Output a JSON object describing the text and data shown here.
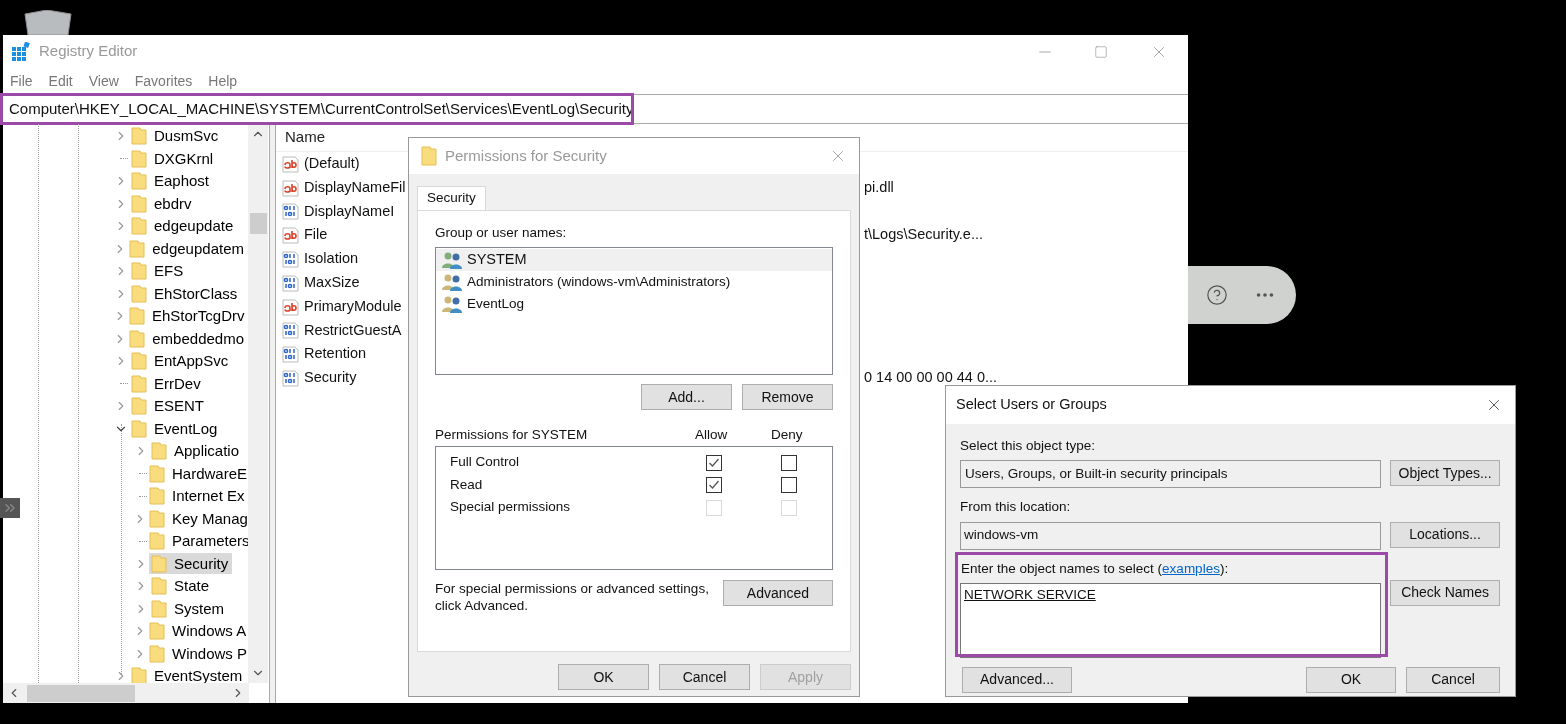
{
  "registry_editor": {
    "title": "Registry Editor",
    "menu": [
      "File",
      "Edit",
      "View",
      "Favorites",
      "Help"
    ],
    "address": "Computer\\HKEY_LOCAL_MACHINE\\SYSTEM\\CurrentControlSet\\Services\\EventLog\\Security",
    "tree": [
      {
        "name": "DusmSvc",
        "kind": "branch",
        "expanded": false,
        "selected": false
      },
      {
        "name": "DXGKrnl",
        "kind": "leaf",
        "selected": false
      },
      {
        "name": "Eaphost",
        "kind": "branch",
        "expanded": false,
        "selected": false
      },
      {
        "name": "ebdrv",
        "kind": "branch",
        "expanded": false,
        "selected": false
      },
      {
        "name": "edgeupdate",
        "kind": "branch",
        "expanded": false,
        "selected": false
      },
      {
        "name": "edgeupdatem",
        "kind": "branch",
        "expanded": false,
        "selected": false
      },
      {
        "name": "EFS",
        "kind": "branch",
        "expanded": false,
        "selected": false
      },
      {
        "name": "EhStorClass",
        "kind": "branch",
        "expanded": false,
        "selected": false
      },
      {
        "name": "EhStorTcgDrv",
        "kind": "branch",
        "expanded": false,
        "selected": false
      },
      {
        "name": "embeddedmo",
        "kind": "branch",
        "expanded": false,
        "selected": false
      },
      {
        "name": "EntAppSvc",
        "kind": "branch",
        "expanded": false,
        "selected": false
      },
      {
        "name": "ErrDev",
        "kind": "leaf",
        "selected": false
      },
      {
        "name": "ESENT",
        "kind": "branch",
        "expanded": false,
        "selected": false
      },
      {
        "name": "EventLog",
        "kind": "branch",
        "expanded": true,
        "selected": false,
        "children": [
          {
            "name": "Applicatio",
            "kind": "branch",
            "expanded": false,
            "selected": false
          },
          {
            "name": "HardwareE",
            "kind": "leaf",
            "selected": false
          },
          {
            "name": "Internet Ex",
            "kind": "leaf",
            "selected": false
          },
          {
            "name": "Key Manag",
            "kind": "branch",
            "expanded": false,
            "selected": false
          },
          {
            "name": "Parameters",
            "kind": "leaf",
            "selected": false
          },
          {
            "name": "Security",
            "kind": "branch",
            "expanded": false,
            "selected": true
          },
          {
            "name": "State",
            "kind": "branch",
            "expanded": false,
            "selected": false
          },
          {
            "name": "System",
            "kind": "branch",
            "expanded": false,
            "selected": false
          },
          {
            "name": "Windows A",
            "kind": "branch",
            "expanded": false,
            "selected": false
          },
          {
            "name": "Windows P",
            "kind": "branch",
            "expanded": false,
            "selected": false
          }
        ]
      },
      {
        "name": "EventSystem",
        "kind": "branch",
        "expanded": false,
        "selected": false
      }
    ],
    "values": {
      "columns": [
        "Name"
      ],
      "rows": [
        {
          "kind": "string",
          "name": "(Default)"
        },
        {
          "kind": "string",
          "name": "DisplayNameFil",
          "data": "pi.dll"
        },
        {
          "kind": "binary",
          "name": "DisplayNameI"
        },
        {
          "kind": "string",
          "name": "File",
          "data": "t\\Logs\\Security.e..."
        },
        {
          "kind": "binary",
          "name": "Isolation"
        },
        {
          "kind": "binary",
          "name": "MaxSize"
        },
        {
          "kind": "string",
          "name": "PrimaryModule"
        },
        {
          "kind": "binary",
          "name": "RestrictGuestA"
        },
        {
          "kind": "binary",
          "name": "Retention"
        },
        {
          "kind": "binary",
          "name": "Security",
          "data": "0 14 00 00 00 44 0..."
        }
      ]
    }
  },
  "permissions_dialog": {
    "title": "Permissions for Security",
    "tabs": [
      {
        "label": "Security",
        "selected": true
      }
    ],
    "group_label": "Group or user names:",
    "principals": [
      {
        "name": "SYSTEM",
        "kind": "system",
        "selected": true
      },
      {
        "name": "Administrators (windows-vm\\Administrators)",
        "kind": "group",
        "selected": false
      },
      {
        "name": "EventLog",
        "kind": "group",
        "selected": false
      }
    ],
    "add_button": "Add...",
    "remove_button": "Remove",
    "permissions_label": "Permissions for SYSTEM",
    "allow_label": "Allow",
    "deny_label": "Deny",
    "permissions": [
      {
        "name": "Full Control",
        "allow": {
          "checked": true,
          "disabled": false
        },
        "deny": {
          "checked": false,
          "disabled": false
        }
      },
      {
        "name": "Read",
        "allow": {
          "checked": true,
          "disabled": false
        },
        "deny": {
          "checked": false,
          "disabled": false
        }
      },
      {
        "name": "Special permissions",
        "allow": {
          "checked": false,
          "disabled": true
        },
        "deny": {
          "checked": false,
          "disabled": true
        }
      }
    ],
    "advanced_note": "For special permissions or advanced settings, click Advanced.",
    "advanced_button": "Advanced",
    "buttons": [
      {
        "label": "OK",
        "disabled": false
      },
      {
        "label": "Cancel",
        "disabled": false
      },
      {
        "label": "Apply",
        "disabled": true
      }
    ]
  },
  "select_dialog": {
    "title": "Select Users or Groups",
    "object_type_label": "Select this object type:",
    "object_type": "Users, Groups, or Built-in security principals",
    "object_types_button": "Object Types...",
    "location_label": "From this location:",
    "location": "windows-vm",
    "locations_button": "Locations...",
    "names_label_before": "Enter the object names to select (",
    "names_link": "examples",
    "names_label_after": "):",
    "names_value": "NETWORK SERVICE",
    "check_names_button": "Check Names",
    "advanced_button": "Advanced...",
    "ok_button": "OK",
    "cancel_button": "Cancel"
  }
}
